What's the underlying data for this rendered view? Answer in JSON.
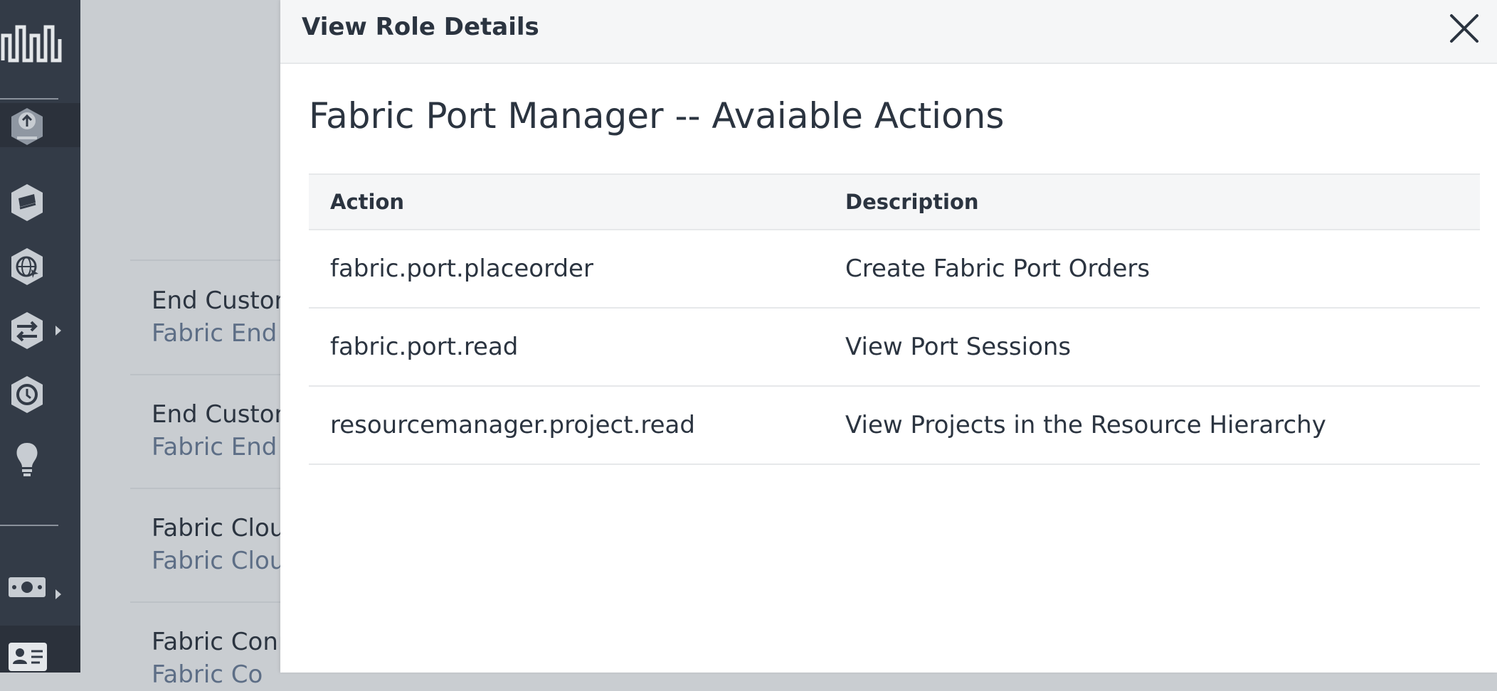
{
  "drawer": {
    "title": "View Role Details",
    "heading": "Fabric Port Manager -- Avaiable Actions",
    "table": {
      "headers": [
        "Action",
        "Description"
      ],
      "rows": [
        {
          "action": "fabric.port.placeorder",
          "description": "Create Fabric Port Orders"
        },
        {
          "action": "fabric.port.read",
          "description": "View Port Sessions"
        },
        {
          "action": "resourcemanager.project.read",
          "description": "View Projects in the Resource Hierarchy"
        }
      ]
    }
  },
  "background": {
    "items": [
      {
        "title": "End Custon",
        "subtitle": "Fabric End"
      },
      {
        "title": "End Custon",
        "subtitle": "Fabric End"
      },
      {
        "title": "Fabric Clou",
        "subtitle": "Fabric Clou"
      },
      {
        "title": "Fabric Conn",
        "subtitle": "Fabric Co"
      }
    ]
  },
  "icons": {
    "nav": [
      "equinix-logo-icon",
      "upload-network-icon",
      "stack-icon",
      "globe-cursor-icon",
      "transfer-icon",
      "clock-icon",
      "lightbulb-icon",
      "billing-icon",
      "contact-card-icon"
    ],
    "close": "close-icon"
  },
  "colors": {
    "nav_bg": "#333b47",
    "text": "#2b3440",
    "subtle_text": "#5d6e86",
    "header_bg": "#f5f6f7"
  }
}
